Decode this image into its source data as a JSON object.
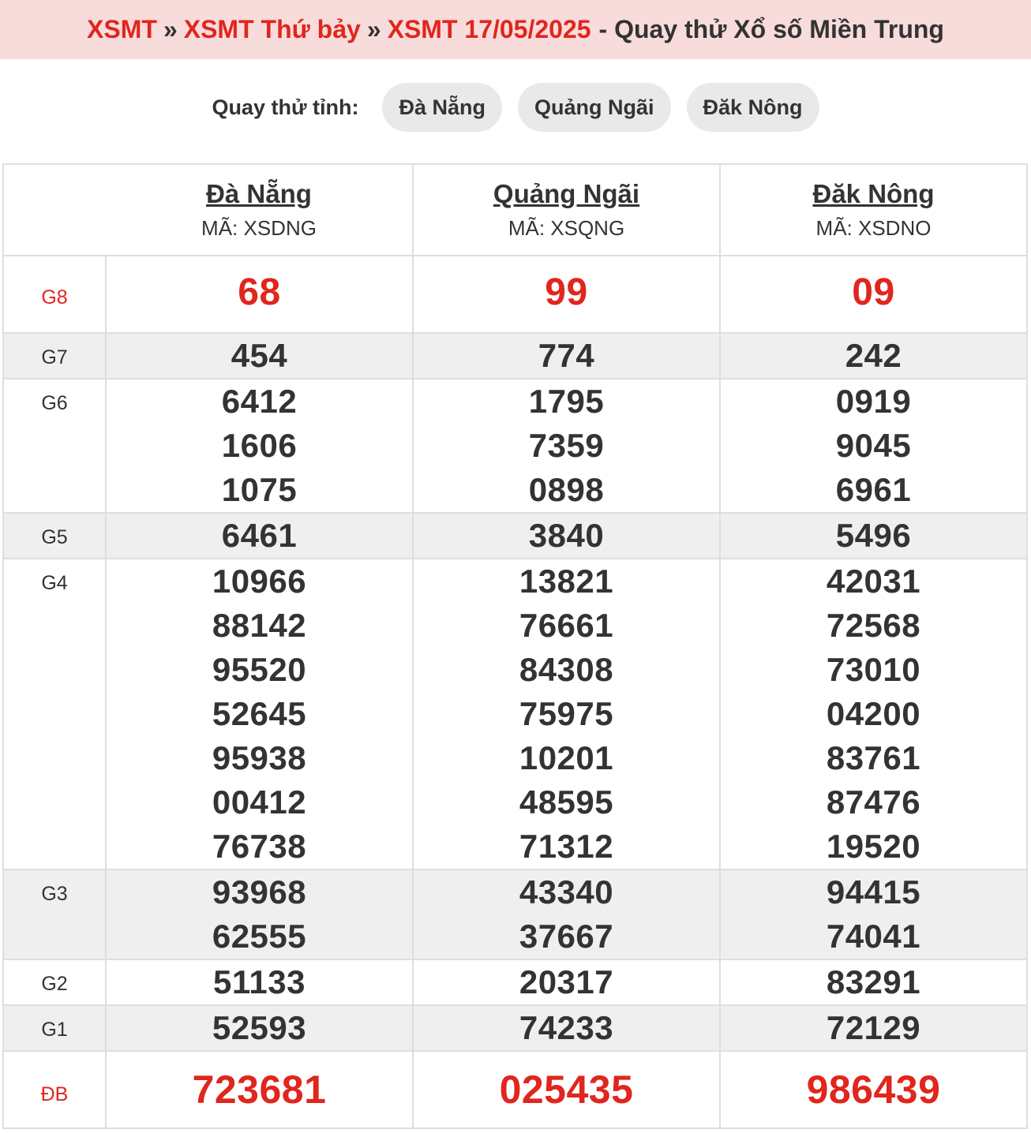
{
  "title": {
    "crumb1": "XSMT",
    "crumb2": "XSMT Thứ bảy",
    "crumb3": "XSMT 17/05/2025",
    "separator": "»",
    "suffix": "- Quay thử Xổ số Miền Trung"
  },
  "provinces_bar": {
    "label": "Quay thử tỉnh:",
    "buttons": [
      "Đà Nẵng",
      "Quảng Ngãi",
      "Đăk Nông"
    ]
  },
  "table": {
    "provinces": [
      {
        "name": "Đà Nẵng",
        "code": "MÃ: XSDNG"
      },
      {
        "name": "Quảng Ngãi",
        "code": "MÃ: XSQNG"
      },
      {
        "name": "Đăk Nông",
        "code": "MÃ: XSDNO"
      }
    ],
    "prizes": {
      "G8": {
        "label": "G8",
        "values": [
          [
            "68"
          ],
          [
            "99"
          ],
          [
            "09"
          ]
        ]
      },
      "G7": {
        "label": "G7",
        "values": [
          [
            "454"
          ],
          [
            "774"
          ],
          [
            "242"
          ]
        ]
      },
      "G6": {
        "label": "G6",
        "values": [
          [
            "6412",
            "1606",
            "1075"
          ],
          [
            "1795",
            "7359",
            "0898"
          ],
          [
            "0919",
            "9045",
            "6961"
          ]
        ]
      },
      "G5": {
        "label": "G5",
        "values": [
          [
            "6461"
          ],
          [
            "3840"
          ],
          [
            "5496"
          ]
        ]
      },
      "G4": {
        "label": "G4",
        "values": [
          [
            "10966",
            "88142",
            "95520",
            "52645",
            "95938",
            "00412",
            "76738"
          ],
          [
            "13821",
            "76661",
            "84308",
            "75975",
            "10201",
            "48595",
            "71312"
          ],
          [
            "42031",
            "72568",
            "73010",
            "04200",
            "83761",
            "87476",
            "19520"
          ]
        ]
      },
      "G3": {
        "label": "G3",
        "values": [
          [
            "93968",
            "62555"
          ],
          [
            "43340",
            "37667"
          ],
          [
            "94415",
            "74041"
          ]
        ]
      },
      "G2": {
        "label": "G2",
        "values": [
          [
            "51133"
          ],
          [
            "20317"
          ],
          [
            "83291"
          ]
        ]
      },
      "G1": {
        "label": "G1",
        "values": [
          [
            "52593"
          ],
          [
            "74233"
          ],
          [
            "72129"
          ]
        ]
      },
      "DB": {
        "label": "ĐB",
        "values": [
          [
            "723681"
          ],
          [
            "025435"
          ],
          [
            "986439"
          ]
        ]
      }
    }
  },
  "colors": {
    "accent_red": "#e0261d",
    "title_bg": "#f8dcdc",
    "shade_row": "#efefef",
    "pill_bg": "#e9e9e9"
  }
}
